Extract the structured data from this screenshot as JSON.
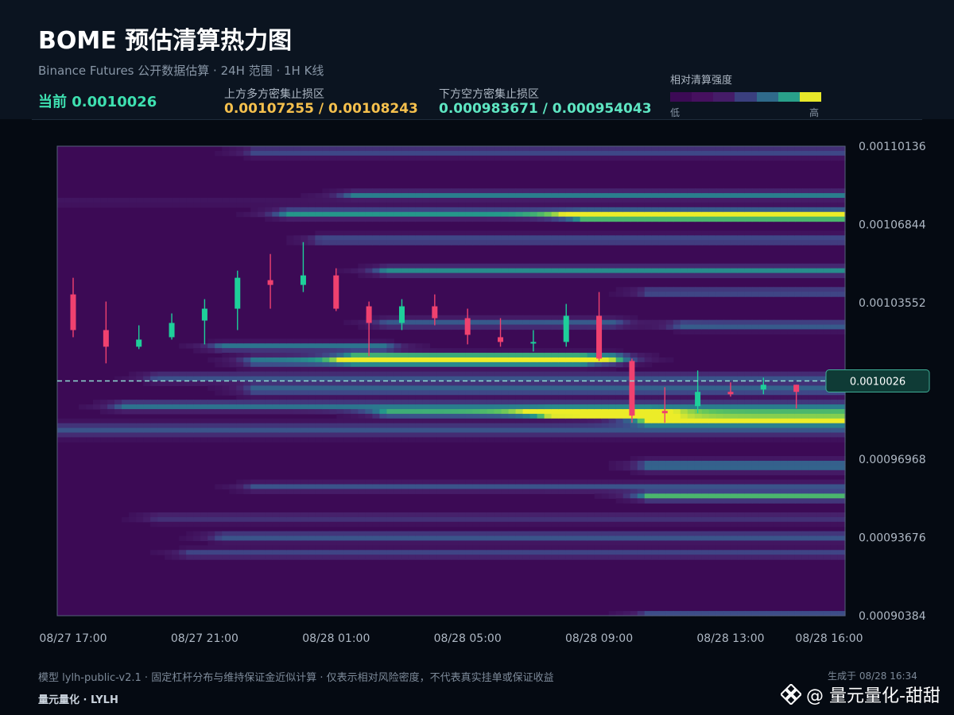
{
  "header": {
    "title": "BOME 预估清算热力图",
    "subtitle": "Binance Futures 公开数据估算 · 24H 范围 · 1H K线",
    "current": "当前 0.0010026",
    "upper_zone_label": "上方多方密集止损区",
    "upper_zone_value": "0.00107255 / 0.00108243",
    "lower_zone_label": "下方空方密集止损区",
    "lower_zone_value": "0.000983671 / 0.000954043"
  },
  "legend": {
    "title": "相对清算强度",
    "low": "低",
    "high": "高",
    "colors": [
      "#3c0a55",
      "#46105f",
      "#451c68",
      "#3a3f7e",
      "#2f6a8b",
      "#29a08a",
      "#e8e82a"
    ]
  },
  "footer": {
    "note": "模型 lylh-public-v2.1 · 固定杠杆分布与维持保证金近似计算 · 仅表示相对风险密度，不代表真实挂单或保证收益",
    "brand": "量元量化 · LYLH",
    "generated": "生成于 08/28 16:34",
    "watermark": "@ 量元量化-甜甜",
    "watermark_icon": "binance-logo-icon"
  },
  "chart_data": {
    "type": "heatmap",
    "x_tick_labels": [
      "08/27 17:00",
      "08/27 21:00",
      "08/28 01:00",
      "08/28 05:00",
      "08/28 09:00",
      "08/28 13:00",
      "08/28 16:00"
    ],
    "y_tick_labels": [
      "0.00110136",
      "0.00106844",
      "0.00103552",
      "0.00096968",
      "0.00093676",
      "0.00090384"
    ],
    "y_tick_values": [
      0.00110136,
      0.00106844,
      0.00103552,
      0.00096968,
      0.00093676,
      0.00090384
    ],
    "ylim": [
      0.00090384,
      0.00110136
    ],
    "hours": 24,
    "current_price": 0.0010026,
    "current_price_label": "0.0010026",
    "candle_up_color": "#1ecf9a",
    "candle_down_color": "#f0416f",
    "current_line_color": "#8fdcd2",
    "candles": [
      {
        "o": 0.001039,
        "c": 0.001024,
        "h": 0.001046,
        "l": 0.001021
      },
      {
        "o": 0.001024,
        "c": 0.001017,
        "h": 0.001036,
        "l": 0.00101
      },
      {
        "o": 0.001017,
        "c": 0.00102,
        "h": 0.001026,
        "l": 0.001016
      },
      {
        "o": 0.001021,
        "c": 0.001027,
        "h": 0.001031,
        "l": 0.00102
      },
      {
        "o": 0.001028,
        "c": 0.001033,
        "h": 0.001037,
        "l": 0.001018
      },
      {
        "o": 0.001033,
        "c": 0.001046,
        "h": 0.001049,
        "l": 0.001024
      },
      {
        "o": 0.001045,
        "c": 0.001043,
        "h": 0.001056,
        "l": 0.001033
      },
      {
        "o": 0.001043,
        "c": 0.001047,
        "h": 0.001061,
        "l": 0.00104
      },
      {
        "o": 0.001047,
        "c": 0.001033,
        "h": 0.00105,
        "l": 0.001032
      },
      {
        "o": 0.001034,
        "c": 0.001027,
        "h": 0.001036,
        "l": 0.001013
      },
      {
        "o": 0.001027,
        "c": 0.001034,
        "h": 0.001037,
        "l": 0.001024
      },
      {
        "o": 0.001034,
        "c": 0.001029,
        "h": 0.001039,
        "l": 0.001026
      },
      {
        "o": 0.001029,
        "c": 0.001022,
        "h": 0.001033,
        "l": 0.001018
      },
      {
        "o": 0.001021,
        "c": 0.001019,
        "h": 0.001029,
        "l": 0.001017
      },
      {
        "o": 0.001019,
        "c": 0.001019,
        "h": 0.001024,
        "l": 0.001015
      },
      {
        "o": 0.001019,
        "c": 0.00103,
        "h": 0.001035,
        "l": 0.001017
      },
      {
        "o": 0.00103,
        "c": 0.001012,
        "h": 0.00104,
        "l": 0.001011
      },
      {
        "o": 0.001011,
        "c": 0.000988,
        "h": 0.001012,
        "l": 0.000985
      },
      {
        "o": 0.00099,
        "c": 0.000989,
        "h": 0.001,
        "l": 0.000985
      },
      {
        "o": 0.000992,
        "c": 0.000998,
        "h": 0.001007,
        "l": 0.000989
      },
      {
        "o": 0.000998,
        "c": 0.000997,
        "h": 0.001002,
        "l": 0.000996
      },
      {
        "o": 0.000999,
        "c": 0.001001,
        "h": 0.001004,
        "l": 0.000997
      },
      {
        "o": 0.001001,
        "c": 0.000998,
        "h": 0.001001,
        "l": 0.000991
      }
    ],
    "heat_bands": [
      {
        "price": 0.001099,
        "width": 2.2e-06,
        "start": 6,
        "end": 24,
        "amp": 0.4
      },
      {
        "price": 0.001081,
        "width": 1.6e-06,
        "start": 9,
        "end": 24,
        "amp": 0.6
      },
      {
        "price": 0.001078,
        "width": 2e-06,
        "start": 0,
        "end": 24,
        "amp": 0.12
      },
      {
        "price": 0.001073,
        "width": 2e-06,
        "start": 7,
        "end": 24,
        "amp": 0.7
      },
      {
        "price": 0.001072,
        "width": 1.8e-06,
        "start": 16,
        "end": 24,
        "amp": 0.95
      },
      {
        "price": 0.001062,
        "width": 2.2e-06,
        "start": 8,
        "end": 24,
        "amp": 0.42
      },
      {
        "price": 0.001049,
        "width": 2e-06,
        "start": 10,
        "end": 24,
        "amp": 0.65
      },
      {
        "price": 0.00104,
        "width": 1.8e-06,
        "start": 18,
        "end": 24,
        "amp": 0.45
      },
      {
        "price": 0.001027,
        "width": 2.2e-06,
        "start": 10,
        "end": 17,
        "amp": 0.45
      },
      {
        "price": 0.001026,
        "width": 2e-06,
        "start": 19,
        "end": 24,
        "amp": 0.5
      },
      {
        "price": 0.001017,
        "width": 1.8e-06,
        "start": 5,
        "end": 10,
        "amp": 0.58
      },
      {
        "price": 0.001011,
        "width": 2.4e-06,
        "start": 6,
        "end": 16,
        "amp": 0.58
      },
      {
        "price": 0.001012,
        "width": 2.2e-06,
        "start": 9,
        "end": 17,
        "amp": 0.85
      },
      {
        "price": 0.001004,
        "width": 2.2e-06,
        "start": 3,
        "end": 24,
        "amp": 0.42
      },
      {
        "price": 0.000999,
        "width": 2.4e-06,
        "start": 6,
        "end": 24,
        "amp": 0.5
      },
      {
        "price": 0.000992,
        "width": 2.2e-06,
        "start": 2,
        "end": 24,
        "amp": 0.55
      },
      {
        "price": 0.000989,
        "width": 1.6e-06,
        "start": 10,
        "end": 24,
        "amp": 0.7
      },
      {
        "price": 0.000989,
        "width": 1.6e-06,
        "start": 15,
        "end": 18,
        "amp": 1.0
      },
      {
        "price": 0.000986,
        "width": 2e-06,
        "start": 18,
        "end": 24,
        "amp": 1.0
      },
      {
        "price": 0.000982,
        "width": 3e-06,
        "start": 0,
        "end": 24,
        "amp": 0.42
      },
      {
        "price": 0.000967,
        "width": 2.6e-06,
        "start": 18,
        "end": 24,
        "amp": 0.55
      },
      {
        "price": 0.000958,
        "width": 2e-06,
        "start": 6,
        "end": 24,
        "amp": 0.42
      },
      {
        "price": 0.000954,
        "width": 1.8e-06,
        "start": 18,
        "end": 24,
        "amp": 0.78
      },
      {
        "price": 0.000945,
        "width": 2.2e-06,
        "start": 3,
        "end": 24,
        "amp": 0.3
      },
      {
        "price": 0.000937,
        "width": 2.2e-06,
        "start": 5,
        "end": 24,
        "amp": 0.45
      },
      {
        "price": 0.00093,
        "width": 2e-06,
        "start": 4,
        "end": 24,
        "amp": 0.38
      },
      {
        "price": 0.000905,
        "width": 1.2e-06,
        "start": 18,
        "end": 24,
        "amp": 0.4
      }
    ]
  }
}
